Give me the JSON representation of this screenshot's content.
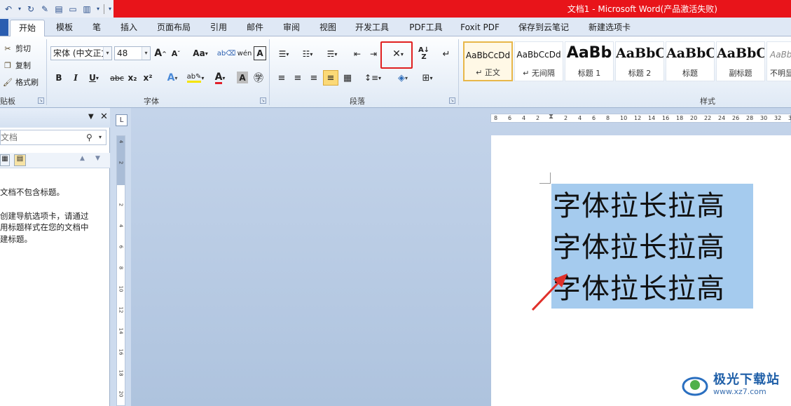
{
  "window": {
    "title": "文档1 - Microsoft Word(产品激活失败)"
  },
  "tabs": [
    {
      "label": "开始",
      "active": true
    },
    {
      "label": "模板"
    },
    {
      "label": "笔"
    },
    {
      "label": "插入"
    },
    {
      "label": "页面布局"
    },
    {
      "label": "引用"
    },
    {
      "label": "邮件"
    },
    {
      "label": "审阅"
    },
    {
      "label": "视图"
    },
    {
      "label": "开发工具"
    },
    {
      "label": "PDF工具"
    },
    {
      "label": "Foxit PDF"
    },
    {
      "label": "保存到云笔记"
    },
    {
      "label": "新建选项卡"
    }
  ],
  "clipboard": {
    "cut": "剪切",
    "copy": "复制",
    "format_painter": "格式刷",
    "group_label": "贴板"
  },
  "font": {
    "font_name": "宋体 (中文正文)",
    "font_size": "48",
    "group_label": "字体",
    "bold": "B",
    "italic": "I",
    "underline": "U",
    "strike": "abc",
    "subscript": "x₂",
    "superscript": "x²",
    "grow": "A",
    "shrink": "A",
    "change_case": "Aa",
    "font_color_letter": "A"
  },
  "paragraph": {
    "group_label": "段落"
  },
  "styles": {
    "group_label": "样式",
    "items": [
      {
        "sample": "AaBbCcDd",
        "name": "↵ 正文",
        "selected": true
      },
      {
        "sample": "AaBbCcDd",
        "name": "↵ 无间隔"
      },
      {
        "sample": "AaBb",
        "name": "标题 1"
      },
      {
        "sample": "AaBbC",
        "name": "标题 2"
      },
      {
        "sample": "AaBbC",
        "name": "标题"
      },
      {
        "sample": "AaBbC",
        "name": "副标题"
      },
      {
        "sample": "AaBbC",
        "name": "不明显"
      }
    ]
  },
  "nav": {
    "search_placeholder": "文档",
    "msg1": "文档不包含标题。",
    "msg2": "创建导航选项卡，请通过",
    "msg3": "用标题样式在您的文档中",
    "msg4": "建标题。"
  },
  "ruler": {
    "corner": "L",
    "hticks": [
      "8",
      "6",
      "4",
      "2",
      "",
      "2",
      "4",
      "6",
      "8",
      "10",
      "12",
      "14",
      "16",
      "18",
      "20",
      "22",
      "24",
      "26",
      "28",
      "30",
      "32",
      "34"
    ],
    "vticks": [
      "4",
      "2",
      "",
      "2",
      "4",
      "6",
      "8",
      "10",
      "12",
      "14",
      "16",
      "18",
      "20"
    ]
  },
  "document": {
    "lines": [
      "字体拉长拉高",
      "字体拉长拉高",
      "字体拉长拉高"
    ]
  },
  "colors": {
    "title_red": "#e8141a",
    "selection": "#a5cbee",
    "highlight": "#e02020",
    "arrow": "#e0302a"
  },
  "watermark": {
    "line1": "极光下载站",
    "line2": "www.xz7.com"
  }
}
